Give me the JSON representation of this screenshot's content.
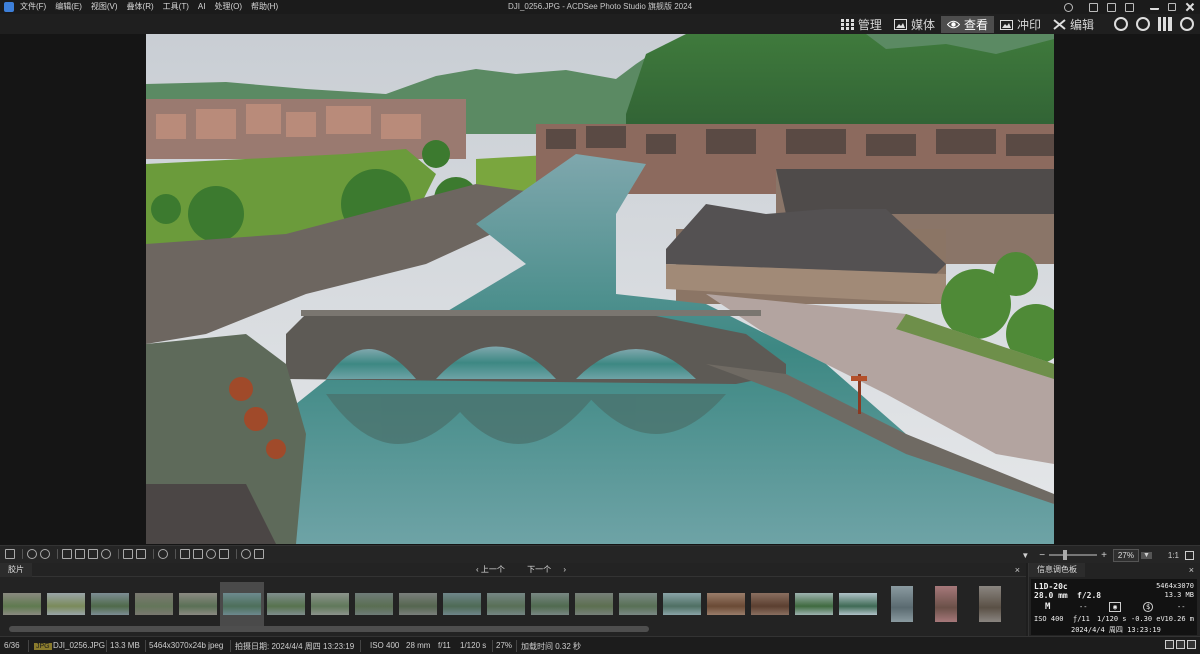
{
  "window": {
    "title": "DJI_0256.JPG - ACDSee Photo Studio 旗舰版 2024"
  },
  "menu": [
    "文件(F)",
    "编辑(E)",
    "视图(V)",
    "叠体(R)",
    "工具(T)",
    "AI",
    "处理(O)",
    "帮助(H)"
  ],
  "modes": [
    {
      "label": "管理",
      "icon": "grid-icon",
      "active": false
    },
    {
      "label": "媒体",
      "icon": "media-icon",
      "active": false
    },
    {
      "label": "查看",
      "icon": "eye-icon",
      "active": true
    },
    {
      "label": "冲印",
      "icon": "develop-icon",
      "active": false
    },
    {
      "label": "编辑",
      "icon": "edit-tools-icon",
      "active": false
    }
  ],
  "extra_icons": [
    "people-icon",
    "360-icon",
    "histogram-icon",
    "eye-icon"
  ],
  "zoom": {
    "value": "27%",
    "ratio": "1:1"
  },
  "filmstrip": {
    "tab": "胶片",
    "prev": "上一个",
    "next": "下一个",
    "close": "×",
    "thumbs": [
      {
        "c1": "#5f7a4f",
        "c2": "#8a8a80",
        "type": "land"
      },
      {
        "c1": "#7a8a5a",
        "c2": "#9aa5a8",
        "type": "land"
      },
      {
        "c1": "#4f6a4a",
        "c2": "#7d8d94",
        "type": "land"
      },
      {
        "c1": "#64765a",
        "c2": "#7a7870",
        "type": "land"
      },
      {
        "c1": "#5a7055",
        "c2": "#8b8a82",
        "type": "land"
      },
      {
        "c1": "#4d6f5a",
        "c2": "#6d8a8f",
        "type": "sel"
      },
      {
        "c1": "#57724e",
        "c2": "#7f8e8d",
        "type": "land"
      },
      {
        "c1": "#60785a",
        "c2": "#8c948c",
        "type": "land"
      },
      {
        "c1": "#5a6e52",
        "c2": "#6f7c78",
        "type": "land"
      },
      {
        "c1": "#55664f",
        "c2": "#7a7f7c",
        "type": "land"
      },
      {
        "c1": "#4e6a55",
        "c2": "#6f868a",
        "type": "land"
      },
      {
        "c1": "#586f56",
        "c2": "#758684",
        "type": "land"
      },
      {
        "c1": "#506a4f",
        "c2": "#788783",
        "type": "land"
      },
      {
        "c1": "#5c6f50",
        "c2": "#778079",
        "type": "land"
      },
      {
        "c1": "#587055",
        "c2": "#7b8985",
        "type": "land"
      },
      {
        "c1": "#4f6f63",
        "c2": "#8aa4a8",
        "type": "land"
      },
      {
        "c1": "#6a4a35",
        "c2": "#9a7d6a",
        "type": "land"
      },
      {
        "c1": "#5b3f30",
        "c2": "#8a6f60",
        "type": "land"
      },
      {
        "c1": "#3f6a3f",
        "c2": "#9eb3b0",
        "type": "land"
      },
      {
        "c1": "#3f6a55",
        "c2": "#b0c2c8",
        "type": "land"
      },
      {
        "c1": "#5a6a70",
        "c2": "#8a9aa0",
        "type": "port"
      },
      {
        "c1": "#6a5048",
        "c2": "#a6787a",
        "type": "port"
      },
      {
        "c1": "#5a5045",
        "c2": "#8a8580",
        "type": "port"
      }
    ]
  },
  "info": {
    "tab": "信息调色板",
    "close": "×",
    "camera": "L1D-20c",
    "dims": "5464x3070",
    "size": "13.3 MB",
    "focal": "28.0 mm",
    "aperture": "f/2.8",
    "mode": "M",
    "dash1": "--",
    "dash2": "--",
    "iso": "ISO 400",
    "fstop": "ƒ/11",
    "shutter": "1/120 s",
    "ev": "-0.30 eV",
    "distance": "10.26 m",
    "date": "2024/4/4 周四 13:23:19"
  },
  "status": {
    "index": "6/36",
    "badge": "JPG",
    "filename": "DJI_0256.JPG",
    "filesize": "13.3 MB",
    "format": "5464x3070x24b jpeg",
    "captured": "拍摄日期: 2024/4/4 周四 13:23:19",
    "iso": "ISO 400",
    "focal": "28 mm",
    "fstop": "f/11",
    "shutter": "1/120 s",
    "zoom": "27%",
    "loadtime": "加载时间 0.32 秒"
  }
}
